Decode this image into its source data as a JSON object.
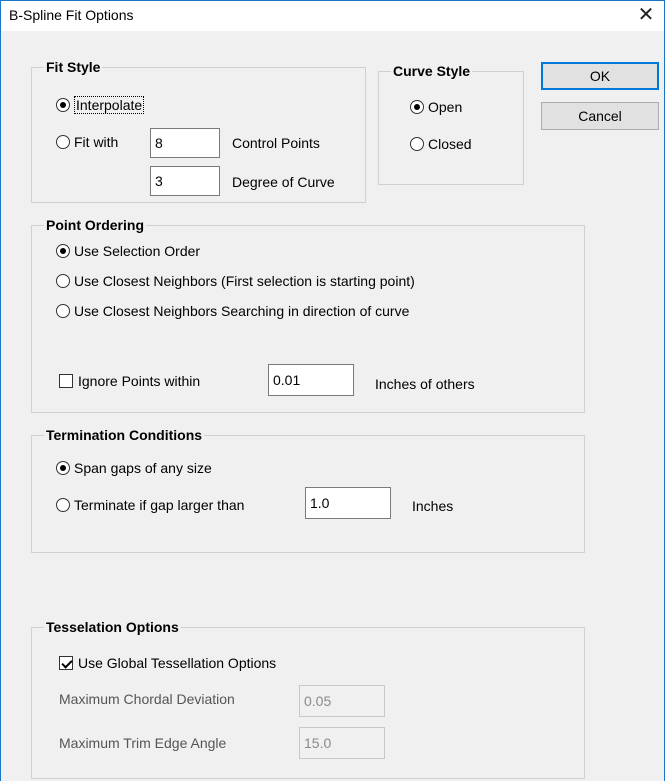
{
  "window": {
    "title": "B-Spline Fit Options",
    "close_glyph": "✕"
  },
  "buttons": {
    "ok": "OK",
    "cancel": "Cancel"
  },
  "fit_style": {
    "legend": "Fit Style",
    "interpolate": "Interpolate",
    "fit_with": "Fit with",
    "control_points_value": "8",
    "control_points_label": "Control Points",
    "degree_value": "3",
    "degree_label": "Degree of Curve",
    "selected": "interpolate"
  },
  "curve_style": {
    "legend": "Curve Style",
    "open": "Open",
    "closed": "Closed",
    "selected": "open"
  },
  "point_ordering": {
    "legend": "Point Ordering",
    "selection_order": "Use Selection Order",
    "closest_first": "Use Closest Neighbors (First selection is starting point)",
    "closest_direction": "Use Closest Neighbors Searching in direction of curve",
    "ignore_label": "Ignore Points within",
    "ignore_value": "0.01",
    "ignore_suffix": "Inches of others",
    "ignore_checked": false,
    "selected": "selection_order"
  },
  "termination": {
    "legend": "Termination Conditions",
    "span": "Span gaps of any size",
    "terminate": "Terminate if gap larger than",
    "gap_value": "1.0",
    "gap_unit": "Inches",
    "selected": "span"
  },
  "tesselation": {
    "legend": "Tesselation Options",
    "use_global": "Use Global Tessellation Options",
    "use_global_checked": true,
    "chordal_label": "Maximum Chordal Deviation",
    "chordal_value": "0.05",
    "trim_label": "Maximum Trim Edge Angle",
    "trim_value": "15.0"
  }
}
